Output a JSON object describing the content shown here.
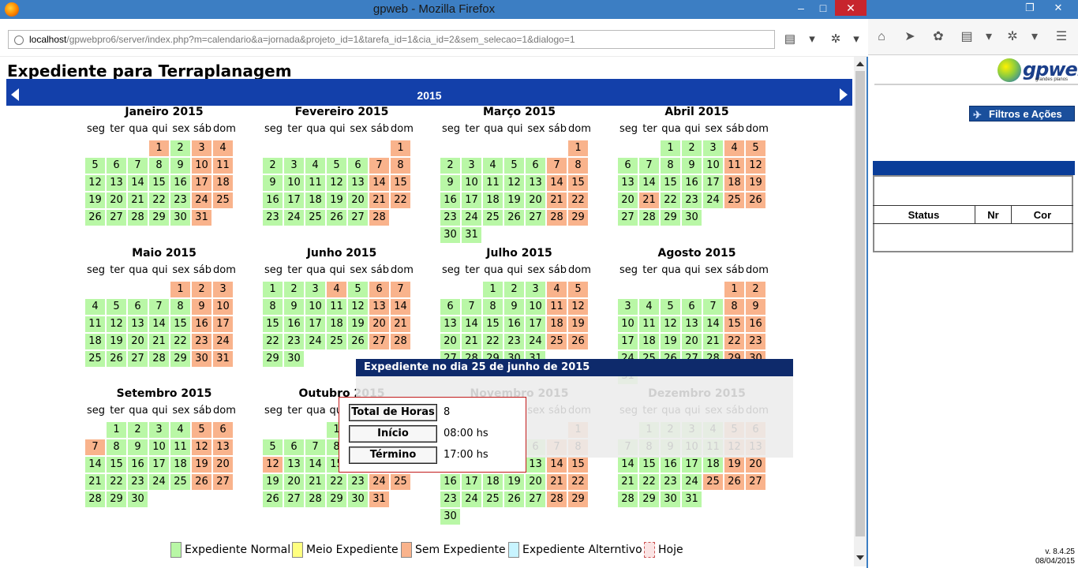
{
  "browser": {
    "title": "gpweb - Mozilla Firefox",
    "url_host": "localhost",
    "url_path": "/gpwebpro6/server/index.php?m=calendario&a=jornada&projeto_id=1&tarefa_id=1&cia_id=2&sem_selecao=1&dialogo=1"
  },
  "page": {
    "title": "Expediente para Terraplanagem",
    "year": "2015"
  },
  "weekdays": [
    "seg",
    "ter",
    "qua",
    "qui",
    "sex",
    "sáb",
    "dom"
  ],
  "legend": [
    {
      "label": "Expediente Normal",
      "color": "#b9f7a6"
    },
    {
      "label": "Meio Expediente",
      "color": "#ffff80"
    },
    {
      "label": "Sem Expediente",
      "color": "#f9b38c"
    },
    {
      "label": "Expediente Alterntivo",
      "color": "#c8f4ff"
    },
    {
      "label": "Hoje",
      "color": "#fbe4e4"
    }
  ],
  "months": [
    {
      "name": "Janeiro 2015",
      "offset": 3,
      "days": 31,
      "off": [
        1
      ]
    },
    {
      "name": "Fevereiro 2015",
      "offset": 6,
      "days": 28,
      "off": []
    },
    {
      "name": "Março 2015",
      "offset": 6,
      "days": 31,
      "off": []
    },
    {
      "name": "Abril 2015",
      "offset": 2,
      "days": 30,
      "off": [
        21
      ]
    },
    {
      "name": "Maio 2015",
      "offset": 4,
      "days": 31,
      "off": [
        1
      ]
    },
    {
      "name": "Junho 2015",
      "offset": 0,
      "days": 30,
      "off": [
        4
      ]
    },
    {
      "name": "Julho 2015",
      "offset": 2,
      "days": 31,
      "off": []
    },
    {
      "name": "Agosto 2015",
      "offset": 5,
      "days": 31,
      "off": []
    },
    {
      "name": "Setembro 2015",
      "offset": 1,
      "days": 30,
      "off": [
        7
      ]
    },
    {
      "name": "Outubro 2015",
      "offset": 3,
      "days": 31,
      "off": [
        12
      ]
    },
    {
      "name": "Novembro 2015",
      "offset": 6,
      "days": 30,
      "off": [
        2
      ]
    },
    {
      "name": "Dezembro 2015",
      "offset": 1,
      "days": 31,
      "off": [
        25
      ]
    }
  ],
  "tooltip": {
    "heading": "Expediente no dia 25 de junho de 2015",
    "total_label": "Total de Horas",
    "total_value": "8",
    "inicio_label": "Início",
    "inicio_value": "08:00 hs",
    "termino_label": "Término",
    "termino_value": "17:00 hs"
  },
  "background_app": {
    "logo_text": "gpweb",
    "logo_sub": "grandes planos",
    "filter_button": "Filtros e Ações",
    "table_headers": [
      "Status",
      "Nr",
      "Cor"
    ],
    "version": "v. 8.4.25",
    "date": "08/04/2015"
  }
}
